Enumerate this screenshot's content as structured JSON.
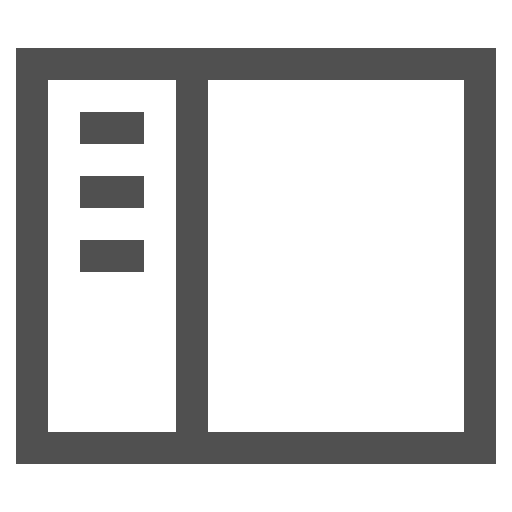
{
  "icon": {
    "name": "sidebar-layout-icon",
    "stroke_color": "#505050",
    "background_color": "#ffffff",
    "sidebar_item_count": 3
  }
}
